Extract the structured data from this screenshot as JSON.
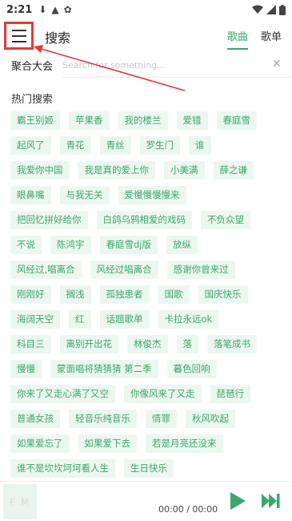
{
  "status_bar": {
    "time": "2:21",
    "icons": [
      "download-icon",
      "a-icon",
      "app-icon"
    ],
    "right_icons": [
      "wifi-icon",
      "signal-icon",
      "battery-icon"
    ]
  },
  "header": {
    "menu_icon": "hamburger-menu-icon",
    "title": "搜索",
    "tabs": [
      {
        "label": "歌曲",
        "active": true
      },
      {
        "label": "歌单",
        "active": false
      }
    ]
  },
  "search": {
    "source_label": "聚合大会",
    "placeholder": "Search for something...",
    "value": "",
    "clear_icon": "close-icon"
  },
  "hot": {
    "title": "热门搜索",
    "rows": [
      [
        "霸王别姬",
        "苹果香",
        "我的楼兰",
        "爱错",
        "春庭雪"
      ],
      [
        "起风了",
        "青花",
        "青丝",
        "罗生门",
        "谁"
      ],
      [
        "我爱你中国",
        "我是真的爱上你",
        "小美满",
        "薛之谦"
      ],
      [
        "眼鼻嘴",
        "与我无关",
        "爱慢慢慢慢来"
      ],
      [
        "把回忆拼好给你",
        "白鸽乌鸦相爱的戏码",
        "不负众望"
      ],
      [
        "不说",
        "陈鸿宇",
        "春庭雪dj版",
        "放纵"
      ],
      [
        "风经过,唱离合",
        "风经过唱离合",
        "感谢你曾来过"
      ],
      [
        "刚刚好",
        "搁浅",
        "孤独患者",
        "国歌",
        "国庆快乐"
      ],
      [
        "海阔天空",
        "红",
        "话题歌单",
        "卡拉永远ok"
      ],
      [
        "科目三",
        "离别开出花",
        "林俊杰",
        "落",
        "落笔成书"
      ],
      [
        "慢慢",
        "蒙面唱将猜猜猜 第二季",
        "暮色回响"
      ],
      [
        "你来了又走心满了又空",
        "你像风来了又走",
        "琵琶行"
      ],
      [
        "普通女孩",
        "轻音乐纯音乐",
        "情罪",
        "秋风吹起"
      ],
      [
        "如果爱忘了",
        "如果爱下去",
        "若是月亮还没来"
      ],
      [
        "谁不是坎坎坷坷看人生",
        "生日快乐"
      ]
    ]
  },
  "player": {
    "cover_text": "F M",
    "time": "00:00 / 00:00",
    "accent": "#3aa86b"
  },
  "colors": {
    "accent": "#3aa86b",
    "tag_bg": "#ecf7f0",
    "highlight": "#e53935"
  }
}
